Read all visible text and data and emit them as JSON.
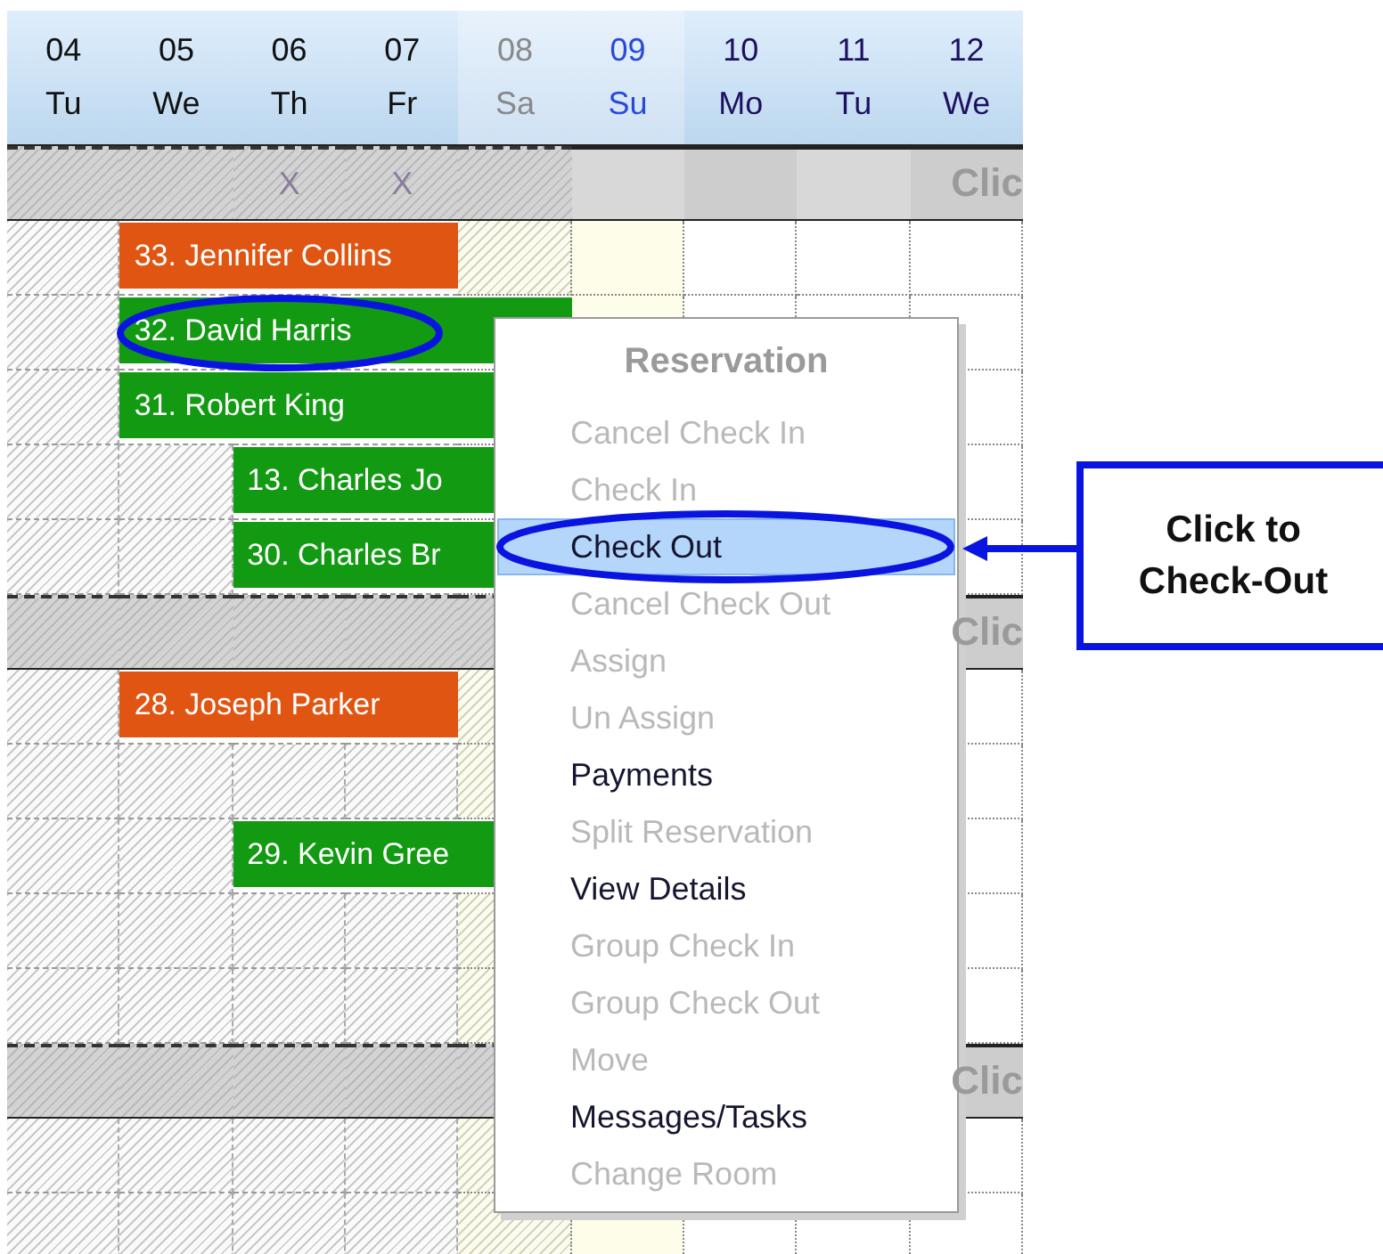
{
  "calendar": {
    "days": [
      {
        "date": "04",
        "weekday": "Tu",
        "kind": "past"
      },
      {
        "date": "05",
        "weekday": "We",
        "kind": "past"
      },
      {
        "date": "06",
        "weekday": "Th",
        "kind": "past"
      },
      {
        "date": "07",
        "weekday": "Fr",
        "kind": "past"
      },
      {
        "date": "08",
        "weekday": "Sa",
        "kind": "weekend-past"
      },
      {
        "date": "09",
        "weekday": "Su",
        "kind": "today"
      },
      {
        "date": "10",
        "weekday": "Mo",
        "kind": "future"
      },
      {
        "date": "11",
        "weekday": "Tu",
        "kind": "future"
      },
      {
        "date": "12",
        "weekday": "We",
        "kind": "future"
      }
    ],
    "sections": [
      {
        "label": "Clic",
        "cells": [
          {},
          {},
          {
            "text": "X"
          },
          {
            "text": "X"
          },
          {},
          {},
          {},
          {},
          {}
        ],
        "rows": [
          {
            "name": "33. Jennifer Collins",
            "kind": "reserved",
            "circled": false,
            "booked": [
              false,
              true,
              true,
              true,
              false,
              false,
              false,
              false,
              false
            ]
          },
          {
            "name": "32. David Harris",
            "kind": "checked-in",
            "circled": true,
            "booked": [
              false,
              true,
              true,
              true,
              true,
              false,
              false,
              false,
              false
            ]
          },
          {
            "name": "31. Robert King",
            "kind": "checked-in",
            "circled": false,
            "booked": [
              false,
              true,
              true,
              true,
              true,
              false,
              false,
              false,
              false
            ]
          },
          {
            "name": "13. Charles Jo",
            "kind": "checked-in",
            "circled": false,
            "booked": [
              false,
              false,
              true,
              true,
              true,
              false,
              false,
              false,
              false
            ]
          },
          {
            "name": "30. Charles Br",
            "kind": "checked-in",
            "circled": false,
            "booked": [
              false,
              false,
              true,
              true,
              true,
              false,
              false,
              false,
              false
            ]
          }
        ]
      },
      {
        "label": "Clic",
        "cells": [
          {},
          {},
          {},
          {},
          {},
          {},
          {},
          {},
          {}
        ],
        "rows": [
          {
            "name": "28. Joseph Parker",
            "kind": "reserved",
            "circled": false,
            "booked": [
              false,
              true,
              true,
              true,
              false,
              false,
              false,
              false,
              false
            ]
          },
          {},
          {
            "name": "29. Kevin Gree",
            "kind": "checked-in",
            "circled": false,
            "booked": [
              false,
              false,
              true,
              true,
              true,
              false,
              false,
              false,
              false
            ]
          },
          {},
          {}
        ]
      },
      {
        "label": "Clic",
        "cells": [
          {},
          {},
          {},
          {},
          {},
          {},
          {},
          {},
          {}
        ],
        "rows": [
          {},
          {}
        ]
      }
    ]
  },
  "context_menu": {
    "title": "Reservation",
    "items": [
      {
        "label": "Cancel Check In",
        "disabled": true,
        "selected": false,
        "circled": false
      },
      {
        "label": "Check In",
        "disabled": true,
        "selected": false,
        "circled": false
      },
      {
        "label": "Check Out",
        "disabled": false,
        "selected": true,
        "circled": true
      },
      {
        "label": "Cancel Check Out",
        "disabled": true,
        "selected": false,
        "circled": false
      },
      {
        "label": "Assign",
        "disabled": true,
        "selected": false,
        "circled": false
      },
      {
        "label": "Un Assign",
        "disabled": true,
        "selected": false,
        "circled": false
      },
      {
        "label": "Payments",
        "disabled": false,
        "selected": false,
        "circled": false
      },
      {
        "label": "Split Reservation",
        "disabled": true,
        "selected": false,
        "circled": false
      },
      {
        "label": "View Details",
        "disabled": false,
        "selected": false,
        "circled": false
      },
      {
        "label": "Group Check In",
        "disabled": true,
        "selected": false,
        "circled": false
      },
      {
        "label": "Group Check Out",
        "disabled": true,
        "selected": false,
        "circled": false
      },
      {
        "label": "Move",
        "disabled": true,
        "selected": false,
        "circled": false
      },
      {
        "label": "Messages/Tasks",
        "disabled": false,
        "selected": false,
        "circled": false
      },
      {
        "label": "Change Room",
        "disabled": true,
        "selected": false,
        "circled": false
      }
    ]
  },
  "callout": {
    "text": "Click to Check-Out"
  }
}
